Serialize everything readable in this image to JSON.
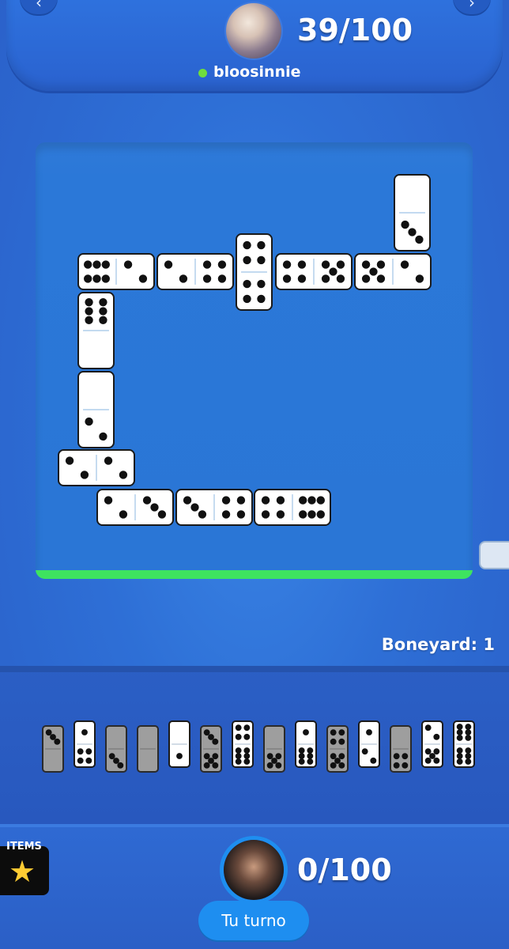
{
  "opponent": {
    "score": "39/100",
    "username": "bloosinnie",
    "status_color": "#6fdc3c"
  },
  "player": {
    "score": "0/100",
    "turn_label": "Tu turno"
  },
  "boneyard": {
    "label": "Boneyard: 1"
  },
  "items": {
    "label": "ITEMS",
    "icon": "star-icon"
  },
  "nav": {
    "left_icon": "back-chevron-icon",
    "right_icon": "forward-chevron-icon"
  },
  "colors": {
    "board_bar": "#3ee35f",
    "turn_button": "#1e8ef0",
    "background": "#2f6fd6"
  },
  "board": {
    "tiles": [
      {
        "a": 0,
        "b": 3
      },
      {
        "a": 6,
        "b": 2
      },
      {
        "a": 2,
        "b": 4
      },
      {
        "a": 4,
        "b": 4
      },
      {
        "a": 4,
        "b": 5
      },
      {
        "a": 5,
        "b": 2
      },
      {
        "a": 6,
        "b": 0
      },
      {
        "a": 0,
        "b": 2
      },
      {
        "a": 2,
        "b": 2
      },
      {
        "a": 2,
        "b": 3
      },
      {
        "a": 3,
        "b": 4
      },
      {
        "a": 4,
        "b": 6
      }
    ]
  },
  "hand": {
    "tiles": [
      {
        "a": 3,
        "b": 0,
        "state": "disabled"
      },
      {
        "a": 1,
        "b": 4,
        "state": "enabled"
      },
      {
        "a": 0,
        "b": 3,
        "state": "disabled"
      },
      {
        "a": 0,
        "b": 0,
        "state": "disabled"
      },
      {
        "a": 0,
        "b": 1,
        "state": "enabled"
      },
      {
        "a": 3,
        "b": 5,
        "state": "disabled"
      },
      {
        "a": 4,
        "b": 6,
        "state": "enabled"
      },
      {
        "a": 0,
        "b": 5,
        "state": "disabled"
      },
      {
        "a": 1,
        "b": 6,
        "state": "enabled"
      },
      {
        "a": 4,
        "b": 5,
        "state": "disabled"
      },
      {
        "a": 1,
        "b": 2,
        "state": "enabled"
      },
      {
        "a": 0,
        "b": 4,
        "state": "disabled"
      },
      {
        "a": 2,
        "b": 5,
        "state": "enabled"
      },
      {
        "a": 6,
        "b": 6,
        "state": "enabled"
      }
    ]
  }
}
